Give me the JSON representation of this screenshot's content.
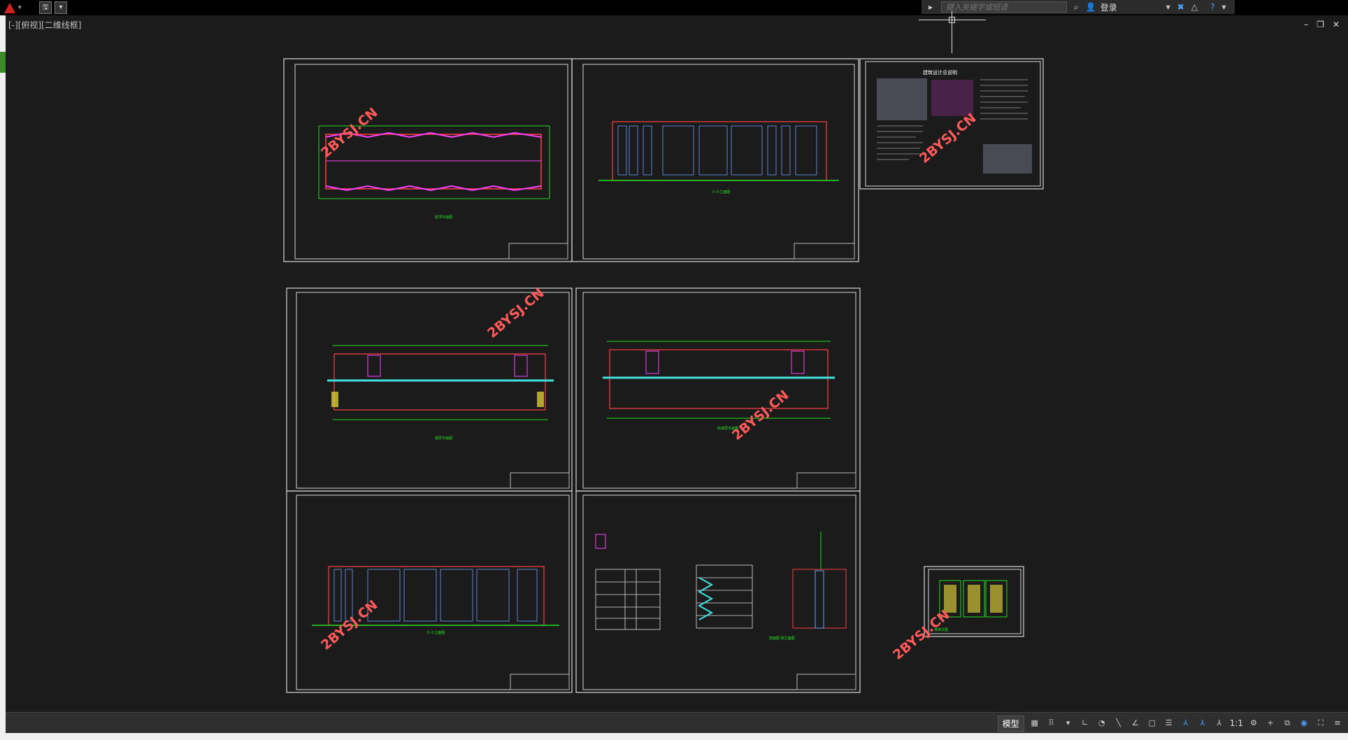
{
  "window": {
    "viewport_label": "[-][俯视][二维线框]",
    "search_placeholder": "键入关键字或短语",
    "login_label": "登录",
    "controls": [
      "–",
      "❐",
      "✕"
    ]
  },
  "quick_access": [
    "🖫",
    "▾"
  ],
  "sheets": [
    {
      "title": "屋顶平面图"
    },
    {
      "title": "①-⑬立面图"
    },
    {
      "title": "建筑设计总说明"
    },
    {
      "title": "首层平面图"
    },
    {
      "title": "标准层平面图"
    },
    {
      "title": "⑬-①立面图"
    },
    {
      "title": "剖面图 侧立面图"
    },
    {
      "title": "楼梯详图"
    }
  ],
  "watermark": "2BYSJ.CN",
  "statusbar": {
    "model_label": "模型",
    "scale_label": "1:1",
    "icons": [
      "grid-icon",
      "snap-icon",
      "ortho-icon",
      "polar-icon",
      "osnap-icon",
      "otrack-icon",
      "lineweight-icon",
      "annotation-icon",
      "workspace-icon",
      "settings-icon",
      "plus-icon",
      "isolate-icon",
      "hardware-icon",
      "fullscreen-icon",
      "menu-icon"
    ]
  },
  "colors": {
    "background": "#1b1b1b",
    "grid_green": "#22e022",
    "frame_red": "#ff4040",
    "watermark": "#ff5a5a",
    "magenta": "#ff40ff",
    "yellow": "#f0e040",
    "cyan": "#40e0e0"
  }
}
